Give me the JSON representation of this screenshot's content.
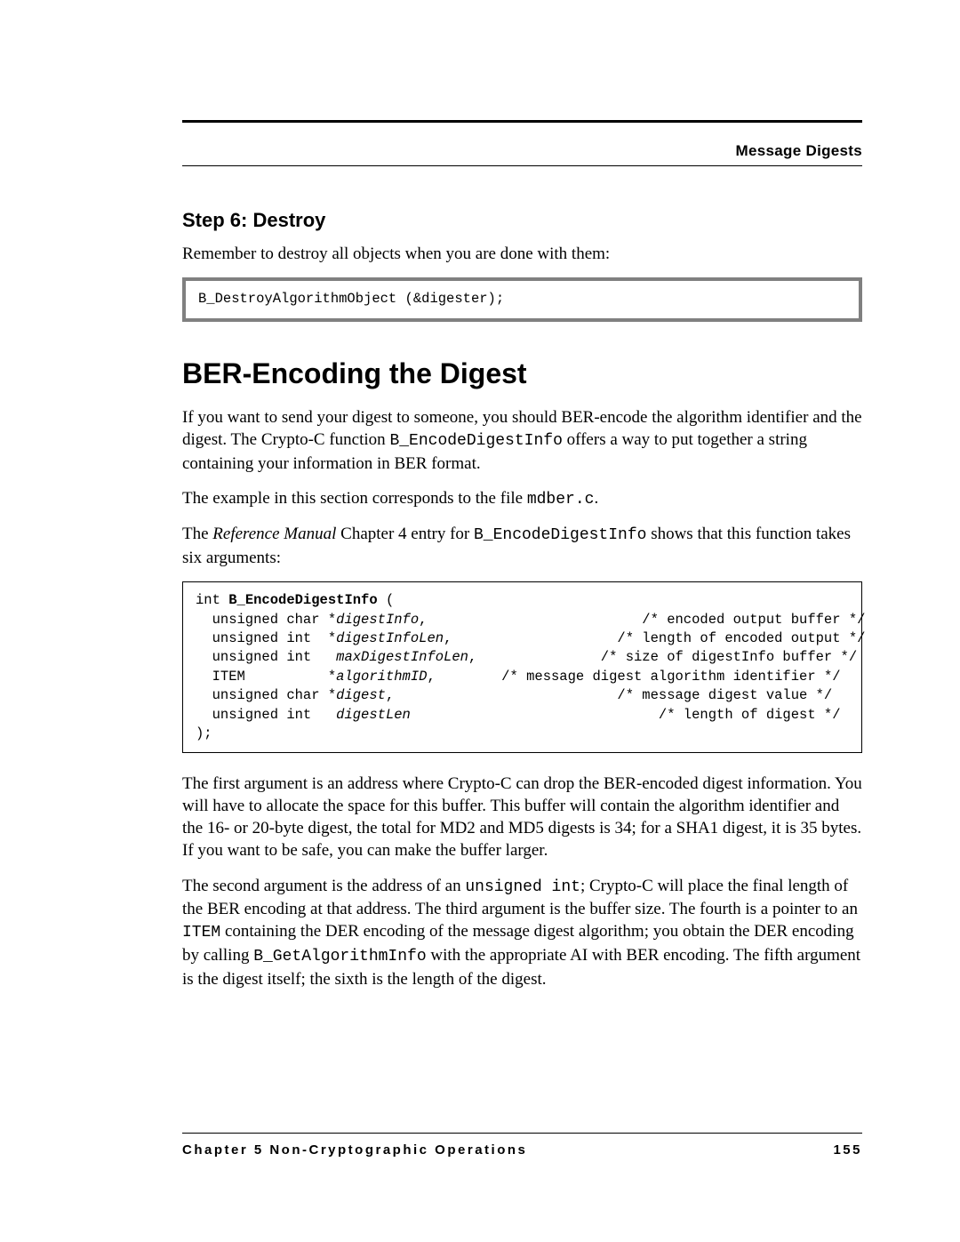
{
  "header": {
    "title": "Message Digests"
  },
  "step": {
    "heading": "Step 6:  Destroy",
    "intro": "Remember to destroy all objects when you are done with them:",
    "code": "B_DestroyAlgorithmObject (&digester);"
  },
  "section": {
    "heading": "BER-Encoding the Digest",
    "p1a": "If you want to send your digest to someone, you should BER-encode the algorithm identifier and the digest. The Crypto-C function ",
    "p1_code": "B_EncodeDigestInfo",
    "p1b": " offers a way to put together a string containing your information in BER format.",
    "p2a": "The example in this section corresponds to the file ",
    "p2_code": "mdber.c",
    "p2b": ".",
    "p3a": "The ",
    "p3_i": "Reference Manual",
    "p3b": " Chapter 4 entry for ",
    "p3_code": "B_EncodeDigestInfo",
    "p3c": " shows that this function takes six arguments:",
    "sig_pre": "int ",
    "sig_name": "B_EncodeDigestInfo",
    "sig_open": " (",
    "sig_l1a": "  unsigned char *",
    "sig_l1i": "digestInfo",
    "sig_l1b": ",                          /* encoded output buffer */",
    "sig_l2a": "  unsigned int  *",
    "sig_l2i": "digestInfoLen",
    "sig_l2b": ",                    /* length of encoded output */",
    "sig_l3a": "  unsigned int   ",
    "sig_l3i": "maxDigestInfoLen",
    "sig_l3b": ",               /* size of digestInfo buffer */",
    "sig_l4a": "  ITEM          *",
    "sig_l4i": "algorithmID",
    "sig_l4b": ",        /* message digest algorithm identifier */",
    "sig_l5a": "  unsigned char *",
    "sig_l5i": "digest",
    "sig_l5b": ",                           /* message digest value */",
    "sig_l6a": "  unsigned int   ",
    "sig_l6i": "digestLen",
    "sig_l6b": "                              /* length of digest */",
    "sig_close": ");",
    "p4": "The first argument is an address where Crypto-C can drop the BER-encoded digest information. You will have to allocate the space for this buffer. This buffer will contain the algorithm identifier and the 16- or 20-byte digest, the total for MD2 and MD5 digests is 34; for a SHA1 digest, it is 35 bytes. If you want to be safe, you can make the buffer larger.",
    "p5a": "The second argument is the address of an ",
    "p5_code1": "unsigned int",
    "p5b": "; Crypto-C will place the final length of the BER encoding at that address. The third argument is the buffer size. The fourth is a pointer to an ",
    "p5_code2": "ITEM",
    "p5c": " containing the DER encoding of the message digest algorithm; you obtain the DER encoding by calling ",
    "p5_code3": "B_GetAlgorithmInfo",
    "p5d": " with the appropriate AI with BER encoding. The fifth argument is the digest itself; the sixth is the length of the digest."
  },
  "footer": {
    "left": "Chapter 5  Non-Cryptographic Operations",
    "right": "155"
  }
}
